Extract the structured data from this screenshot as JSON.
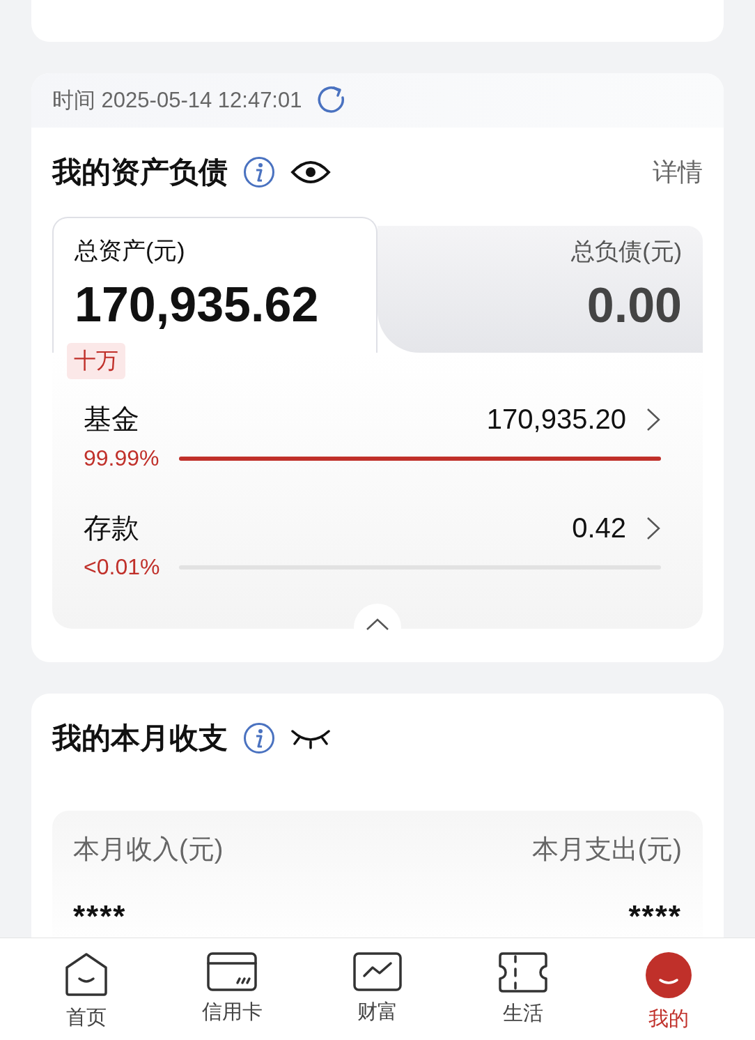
{
  "assets": {
    "timestamp": "时间 2025-05-14 12:47:01",
    "title": "我的资产负债",
    "hidden": false,
    "detail_link": "详情",
    "tabs": [
      {
        "label": "总资产(元)",
        "amount": "170,935.62",
        "badge": "十万",
        "selected": true
      },
      {
        "label": "总负债(元)",
        "amount": "0.00",
        "selected": false
      }
    ],
    "items": [
      {
        "name": "基金",
        "value": "170,935.20",
        "percent": "99.99%",
        "level": 0.9999
      },
      {
        "name": "存款",
        "value": "0.42",
        "percent": "<0.01%",
        "level": 0
      }
    ],
    "expanded": true
  },
  "monthly": {
    "title": "我的本月收支",
    "hidden": true,
    "columns": [
      {
        "label": "本月收入(元)",
        "value": "****"
      },
      {
        "label": "本月支出(元)",
        "value": "****"
      }
    ]
  },
  "tab_bar": [
    {
      "label": "首页",
      "selected": false
    },
    {
      "label": "信用卡",
      "selected": false
    },
    {
      "label": "财富",
      "selected": false
    },
    {
      "label": "生活",
      "selected": false
    },
    {
      "label": "我的",
      "selected": true
    }
  ]
}
